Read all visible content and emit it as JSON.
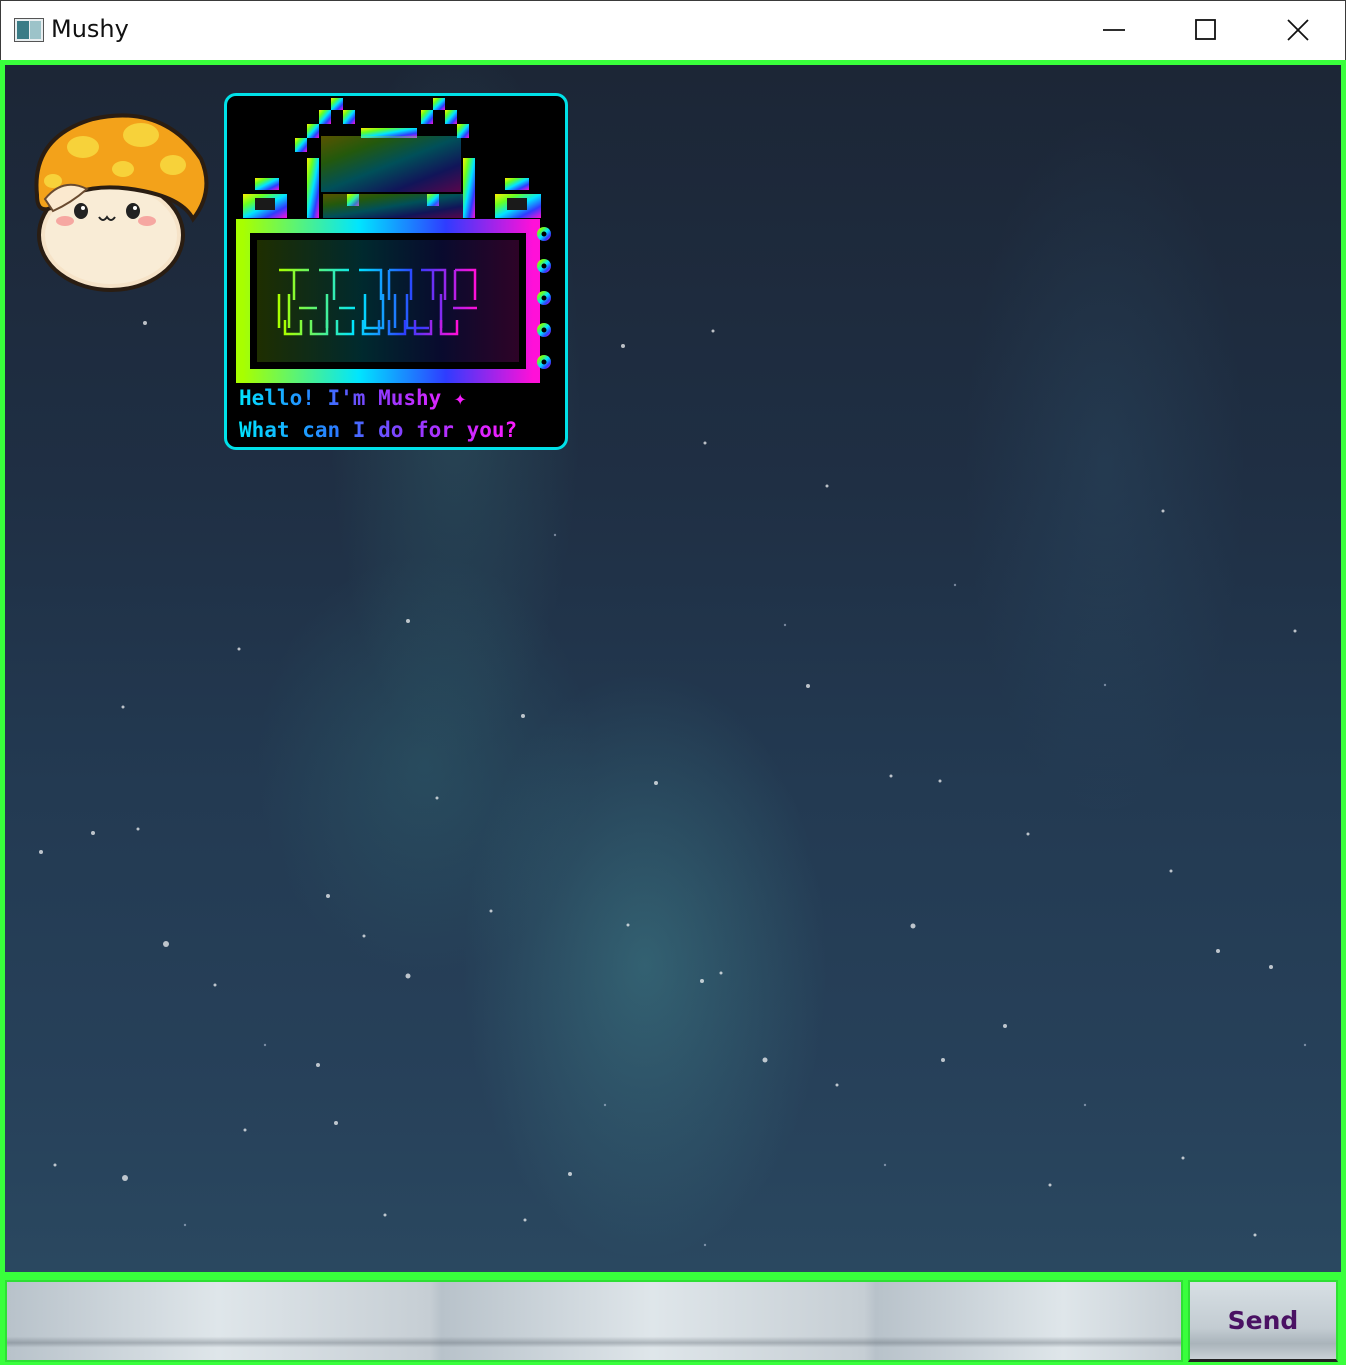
{
  "window": {
    "title": "Mushy",
    "controls": [
      "minimize",
      "maximize",
      "close"
    ]
  },
  "chat": {
    "messages": [
      {
        "sender": "bot",
        "avatar_icon": "orange-mushroom-icon",
        "lines": [
          "Hello! I'm Mushy ✦",
          "What can I do for you?"
        ]
      }
    ]
  },
  "input": {
    "value": "",
    "placeholder": ""
  },
  "send_button": {
    "label": "Send"
  },
  "colors": {
    "accent_border": "#39ff3c",
    "bubble_border": "#00e1e8",
    "send_text": "#4a1163"
  }
}
